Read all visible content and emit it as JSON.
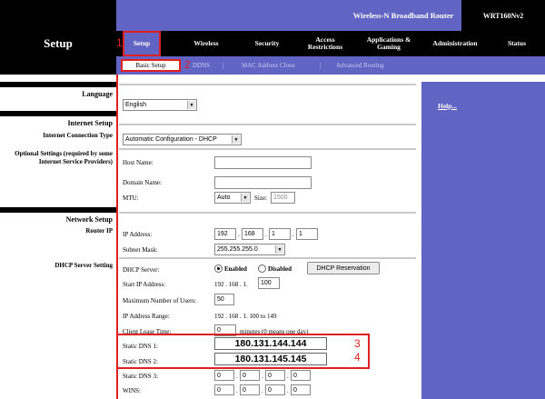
{
  "header": {
    "product": "Wireless-N Broadband Router",
    "model": "WRT160Nv2",
    "section": "Setup"
  },
  "nav": {
    "tabs": [
      {
        "label": "Setup"
      },
      {
        "label": "Wireless"
      },
      {
        "label": "Security"
      },
      {
        "label": "Access Restrictions"
      },
      {
        "label": "Applications & Gaming"
      },
      {
        "label": "Administration"
      },
      {
        "label": "Status"
      }
    ]
  },
  "subnav": {
    "items": [
      "Basic Setup",
      "DDNS",
      "MAC Address Clone",
      "Advanced Routing"
    ],
    "sep": "|"
  },
  "callouts": [
    "1",
    "2",
    "3",
    "4"
  ],
  "left": {
    "language": "Language",
    "internet_setup": "Internet Setup",
    "conn_type": "Internet Connection Type",
    "optional": "Optional Settings (required by some Internet Service Providers)",
    "network_setup": "Network Setup",
    "router_ip": "Router IP",
    "dhcp": "DHCP Server Setting"
  },
  "form": {
    "language": "English",
    "conn_type": "Automatic Configuration - DHCP",
    "host_name_label": "Host Name:",
    "host_name": "",
    "domain_name_label": "Domain Name:",
    "domain_name": "",
    "mtu_label": "MTU:",
    "mtu_mode": "Auto",
    "size_label": "Size:",
    "size": "1500",
    "ip_label": "IP Address:",
    "ip": [
      "192",
      "168",
      "1",
      "1"
    ],
    "mask_label": "Subnet Mask:",
    "mask": "255.255.255.0",
    "dhcp_server_label": "DHCP Server:",
    "enabled": "Enabled",
    "disabled": "Disabled",
    "dhcp_reservation": "DHCP Reservation",
    "start_ip_label": "Start IP Address:",
    "start_ip_prefix": "192 . 168 . 1.",
    "start_ip": "100",
    "max_users_label": "Maximum Number of Users:",
    "max_users": "50",
    "range_label": "IP Address Range:",
    "range": "192 . 168 . 1. 100 to 149",
    "lease_label": "Client Lease Time:",
    "lease": "0",
    "lease_unit": "minutes (0 means one day)",
    "dns1_label": "Static DNS 1:",
    "dns1": "180.131.144.144",
    "dns2_label": "Static DNS 2:",
    "dns2": "180.131.145.145",
    "dns3_label": "Static DNS 3:",
    "dns3": [
      "0",
      "0",
      "0",
      "0"
    ],
    "wins_label": "WINS:",
    "wins": [
      "0",
      "0",
      "0",
      "0"
    ],
    "dot": "."
  },
  "help": "Help..."
}
